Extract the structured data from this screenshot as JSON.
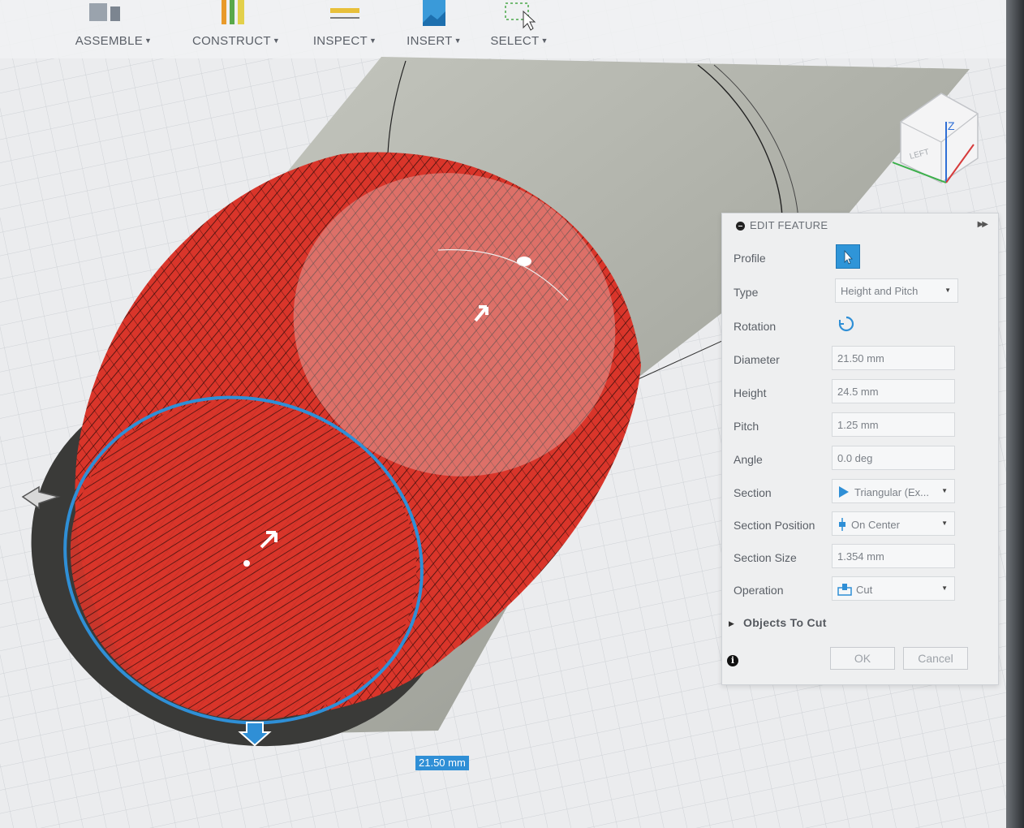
{
  "toolbar": {
    "items": [
      {
        "label": "ASSEMBLE"
      },
      {
        "label": "CONSTRUCT"
      },
      {
        "label": "INSPECT"
      },
      {
        "label": "INSERT"
      },
      {
        "label": "SELECT"
      }
    ]
  },
  "viewcube": {
    "left_label": "LEFT",
    "z_label": "Z"
  },
  "dimension_input": {
    "value": "21.50 mm"
  },
  "edit_feature": {
    "title": "EDIT FEATURE",
    "rows": {
      "profile": {
        "label": "Profile"
      },
      "type": {
        "label": "Type",
        "value": "Height and Pitch"
      },
      "rotation": {
        "label": "Rotation"
      },
      "diameter": {
        "label": "Diameter",
        "value": "21.50 mm"
      },
      "height": {
        "label": "Height",
        "value": "24.5 mm"
      },
      "pitch": {
        "label": "Pitch",
        "value": "1.25 mm"
      },
      "angle": {
        "label": "Angle",
        "value": "0.0 deg"
      },
      "section": {
        "label": "Section",
        "value": "Triangular (Ex..."
      },
      "section_position": {
        "label": "Section Position",
        "value": "On Center"
      },
      "section_size": {
        "label": "Section Size",
        "value": "1.354 mm"
      },
      "operation": {
        "label": "Operation",
        "value": "Cut"
      }
    },
    "objects_to_cut": "Objects To Cut",
    "ok_label": "OK",
    "cancel_label": "Cancel"
  },
  "colors": {
    "thread_red": "#d9352a",
    "selection_blue": "#2f8fd6",
    "body_gray": "#b6b8b0",
    "panel_bg": "#eeeff0"
  },
  "icons": {
    "profile": "cursor-select-icon",
    "rotation": "rotate-icon",
    "section": "triangle-section-icon",
    "section_position": "center-position-icon",
    "operation": "cut-icon"
  }
}
